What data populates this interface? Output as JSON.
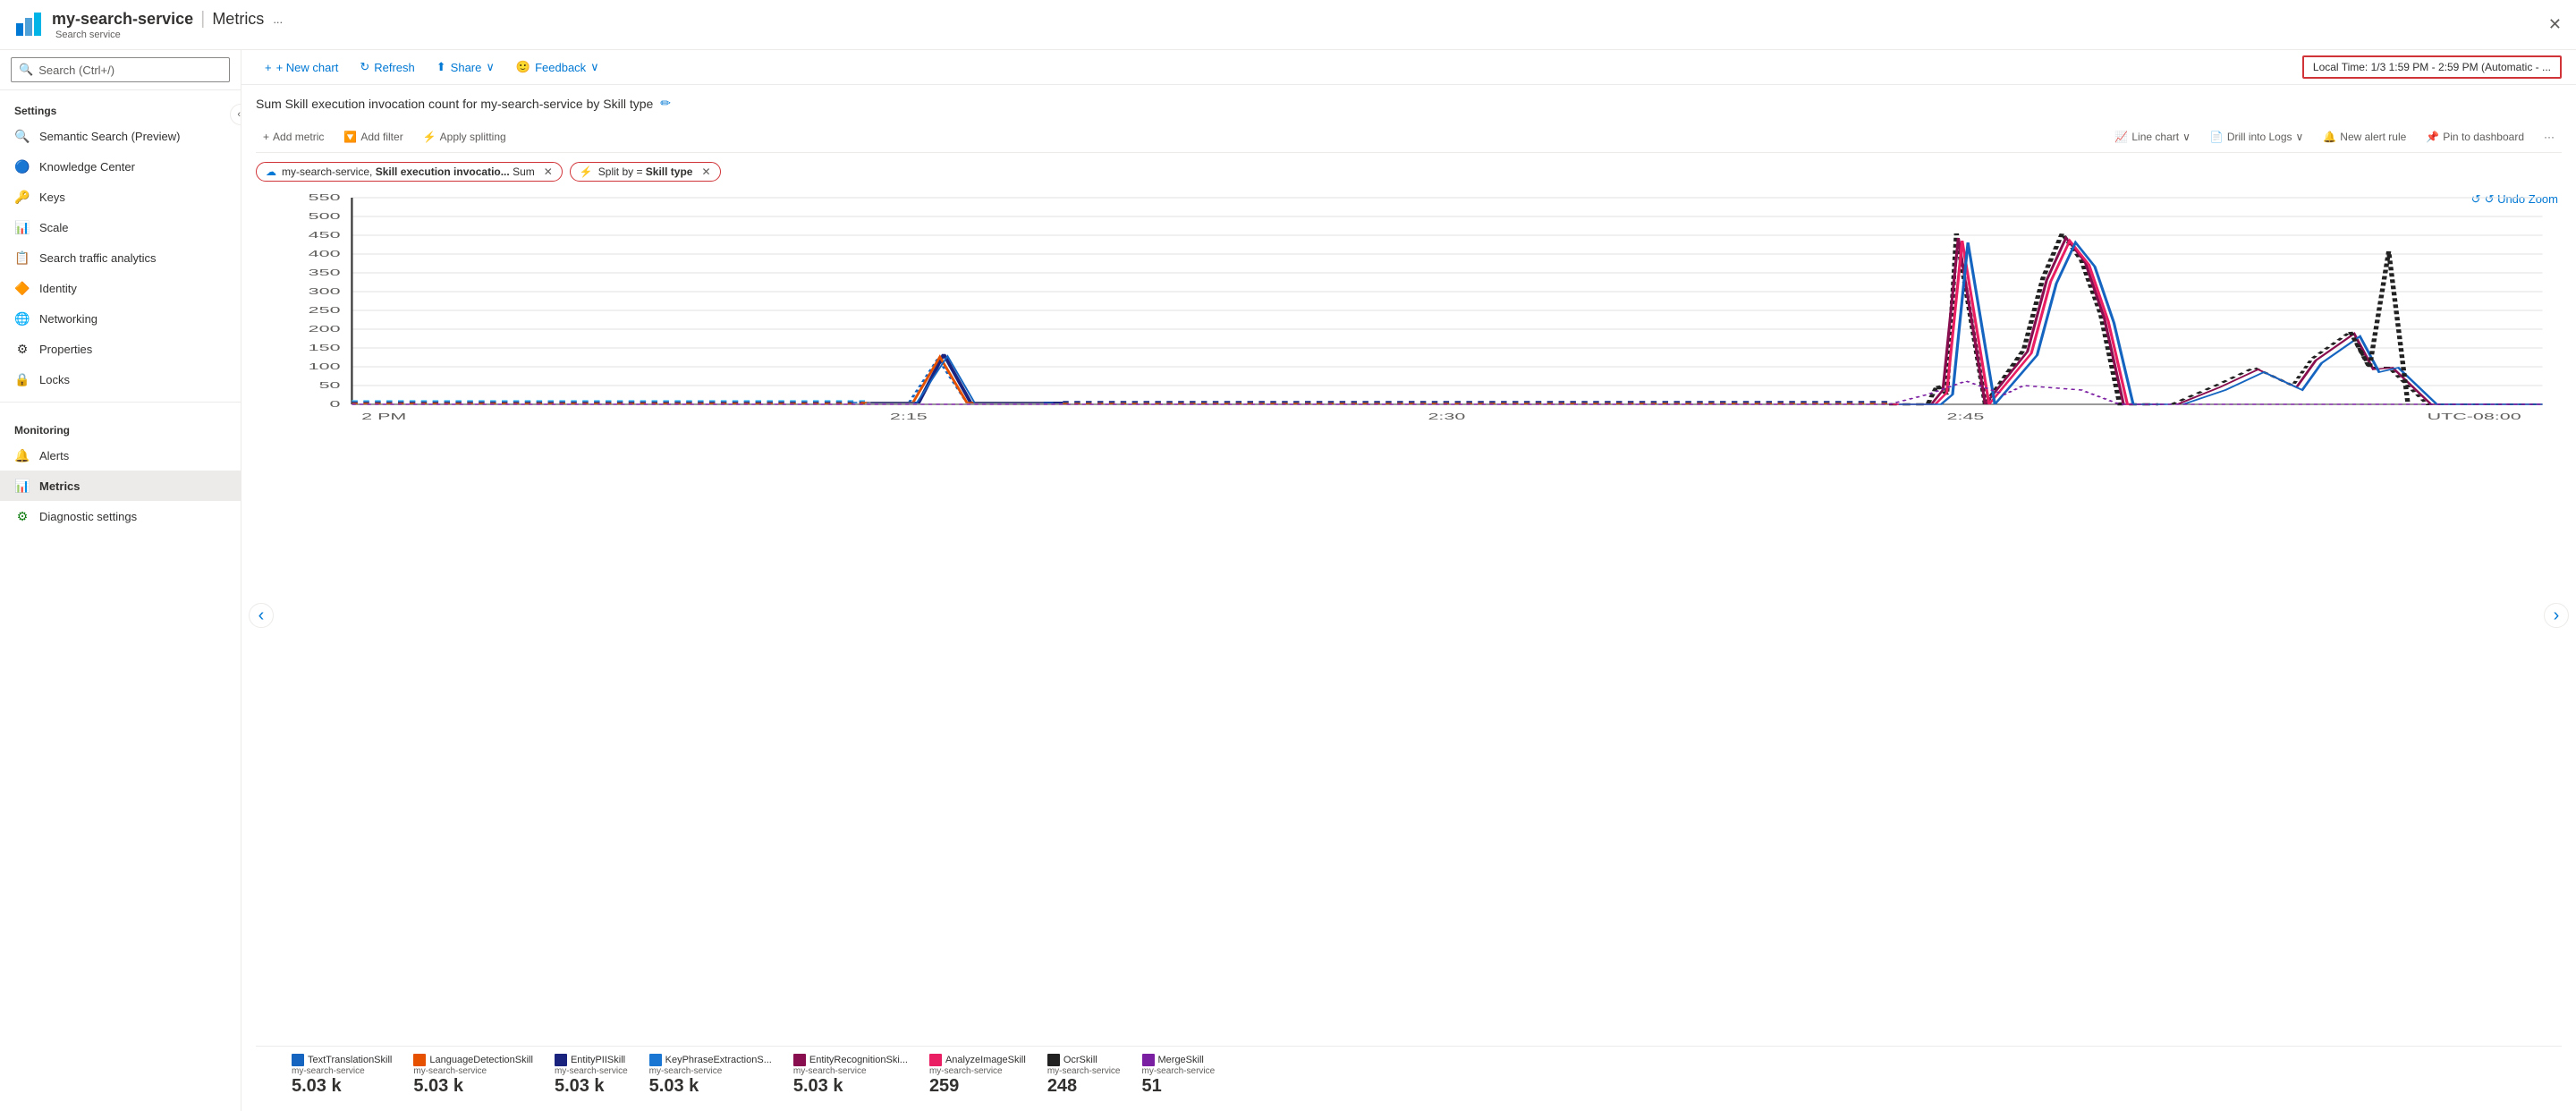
{
  "header": {
    "icon_color": "#0078d4",
    "service_name": "my-search-service",
    "separator": "|",
    "page_title": "Metrics",
    "ellipsis": "...",
    "service_label": "Search service",
    "close_label": "✕"
  },
  "toolbar": {
    "new_chart_label": "+ New chart",
    "refresh_label": "↻ Refresh",
    "share_label": "⬆ Share",
    "share_chevron": "∨",
    "feedback_label": "🙂 Feedback",
    "feedback_chevron": "∨",
    "time_range_label": "Local Time: 1/3 1:59 PM - 2:59 PM (Automatic - ..."
  },
  "sidebar": {
    "search_placeholder": "Search (Ctrl+/)",
    "sections": [
      {
        "label": "Settings",
        "items": [
          {
            "icon": "🔍",
            "label": "Semantic Search (Preview)",
            "active": false
          },
          {
            "icon": "🔵",
            "label": "Knowledge Center",
            "active": false
          },
          {
            "icon": "🔑",
            "label": "Keys",
            "active": false
          },
          {
            "icon": "📊",
            "label": "Scale",
            "active": false
          },
          {
            "icon": "📋",
            "label": "Search traffic analytics",
            "active": false
          },
          {
            "icon": "🔶",
            "label": "Identity",
            "active": false
          },
          {
            "icon": "🌐",
            "label": "Networking",
            "active": false
          },
          {
            "icon": "⚙",
            "label": "Properties",
            "active": false
          },
          {
            "icon": "🔒",
            "label": "Locks",
            "active": false
          }
        ]
      },
      {
        "label": "Monitoring",
        "items": [
          {
            "icon": "🔔",
            "label": "Alerts",
            "active": false
          },
          {
            "icon": "📊",
            "label": "Metrics",
            "active": true
          },
          {
            "icon": "⚙",
            "label": "Diagnostic settings",
            "active": false
          }
        ]
      }
    ]
  },
  "chart": {
    "title": "Sum Skill execution invocation count for my-search-service by Skill type",
    "edit_icon": "✏",
    "toolbar": {
      "add_metric": "+ Add metric",
      "add_filter": "🔽 Add filter",
      "apply_splitting": "⚡ Apply splitting",
      "line_chart": "📈 Line chart",
      "line_chart_chevron": "∨",
      "drill_into_logs": "📄 Drill into Logs",
      "drill_chevron": "∨",
      "new_alert_rule": "🔔 New alert rule",
      "pin_to_dashboard": "📌 Pin to dashboard",
      "more": "···"
    },
    "metric_tags": [
      {
        "icon": "☁",
        "text": "my-search-service, Skill execution invocatio... Sum"
      },
      {
        "icon": "⚡",
        "text": "Split by = Skill type"
      }
    ],
    "undo_zoom": "↺ Undo Zoom",
    "y_axis": [
      550,
      500,
      450,
      400,
      350,
      300,
      250,
      200,
      150,
      100,
      50,
      0
    ],
    "x_axis": [
      "2 PM",
      "2:15",
      "2:30",
      "2:45",
      "UTC-08:00"
    ],
    "legend": [
      {
        "color": "#1565c0",
        "label": "TextTranslationSkill",
        "service": "my-search-service",
        "value": "5.03 k"
      },
      {
        "color": "#e65100",
        "label": "LanguageDetectionSkill",
        "service": "my-search-service",
        "value": "5.03 k"
      },
      {
        "color": "#1a237e",
        "label": "EntityPIISkill",
        "service": "my-search-service",
        "value": "5.03 k"
      },
      {
        "color": "#1565c0",
        "label": "KeyPhraseExtractionS...",
        "service": "my-search-service",
        "value": "5.03 k"
      },
      {
        "color": "#880e4f",
        "label": "EntityRecognitionSki...",
        "service": "my-search-service",
        "value": "5.03 k"
      },
      {
        "color": "#e91e63",
        "label": "AnalyzeImageSkill",
        "service": "my-search-service",
        "value": "259"
      },
      {
        "color": "#212121",
        "label": "OcrSkill",
        "service": "my-search-service",
        "value": "248"
      },
      {
        "color": "#7b1fa2",
        "label": "MergeSkill",
        "service": "my-search-service",
        "value": "51"
      }
    ]
  }
}
